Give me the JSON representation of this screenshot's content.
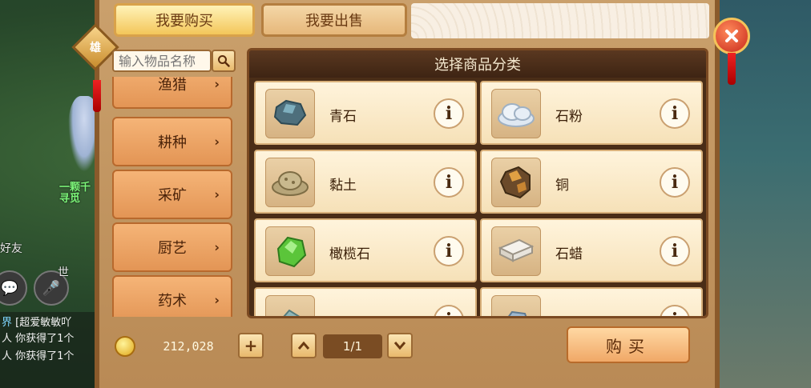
{
  "tabs": {
    "buy": "我要购买",
    "sell": "我要出售"
  },
  "search": {
    "placeholder": "输入物品名称"
  },
  "categories": [
    {
      "label": "渔猎"
    },
    {
      "label": "耕种"
    },
    {
      "label": "采矿"
    },
    {
      "label": "厨艺"
    },
    {
      "label": "药术"
    }
  ],
  "goods": {
    "title": "选择商品分类",
    "items": [
      {
        "name": "青石",
        "icon": "blue-stone-icon",
        "color": "#4e6f7c"
      },
      {
        "name": "石粉",
        "icon": "stone-powder-icon",
        "color": "#dfe8f2"
      },
      {
        "name": "黏土",
        "icon": "clay-icon",
        "color": "#b7a579"
      },
      {
        "name": "铜",
        "icon": "copper-ore-icon",
        "color": "#b8782f"
      },
      {
        "name": "橄榄石",
        "icon": "olivine-icon",
        "color": "#5bc53a"
      },
      {
        "name": "石蜡",
        "icon": "paraffin-icon",
        "color": "#e8e4dc"
      },
      {
        "name": "",
        "icon": "ore-icon",
        "color": "#8fb6b8"
      },
      {
        "name": "",
        "icon": "ore-icon",
        "color": "#9eb8cf"
      }
    ]
  },
  "footer": {
    "money": "212,028",
    "add_symbol": "+",
    "page": "1/1",
    "buy_label": "购买"
  },
  "world": {
    "npc_label_1": "一颗千",
    "npc_label_2": "寻觅",
    "friends_label": "好友",
    "world_label": "世",
    "chat": [
      {
        "tag": "界",
        "text": "[超爱敏敏吖"
      },
      {
        "tag": "人",
        "text": "你获得了1个"
      },
      {
        "tag": "人",
        "text": "你获得了1个"
      }
    ]
  },
  "badge": {
    "text": "雄"
  },
  "colors": {
    "panel": "#caa06c",
    "accent_red": "#c8281b",
    "card": "#fff4dc"
  }
}
